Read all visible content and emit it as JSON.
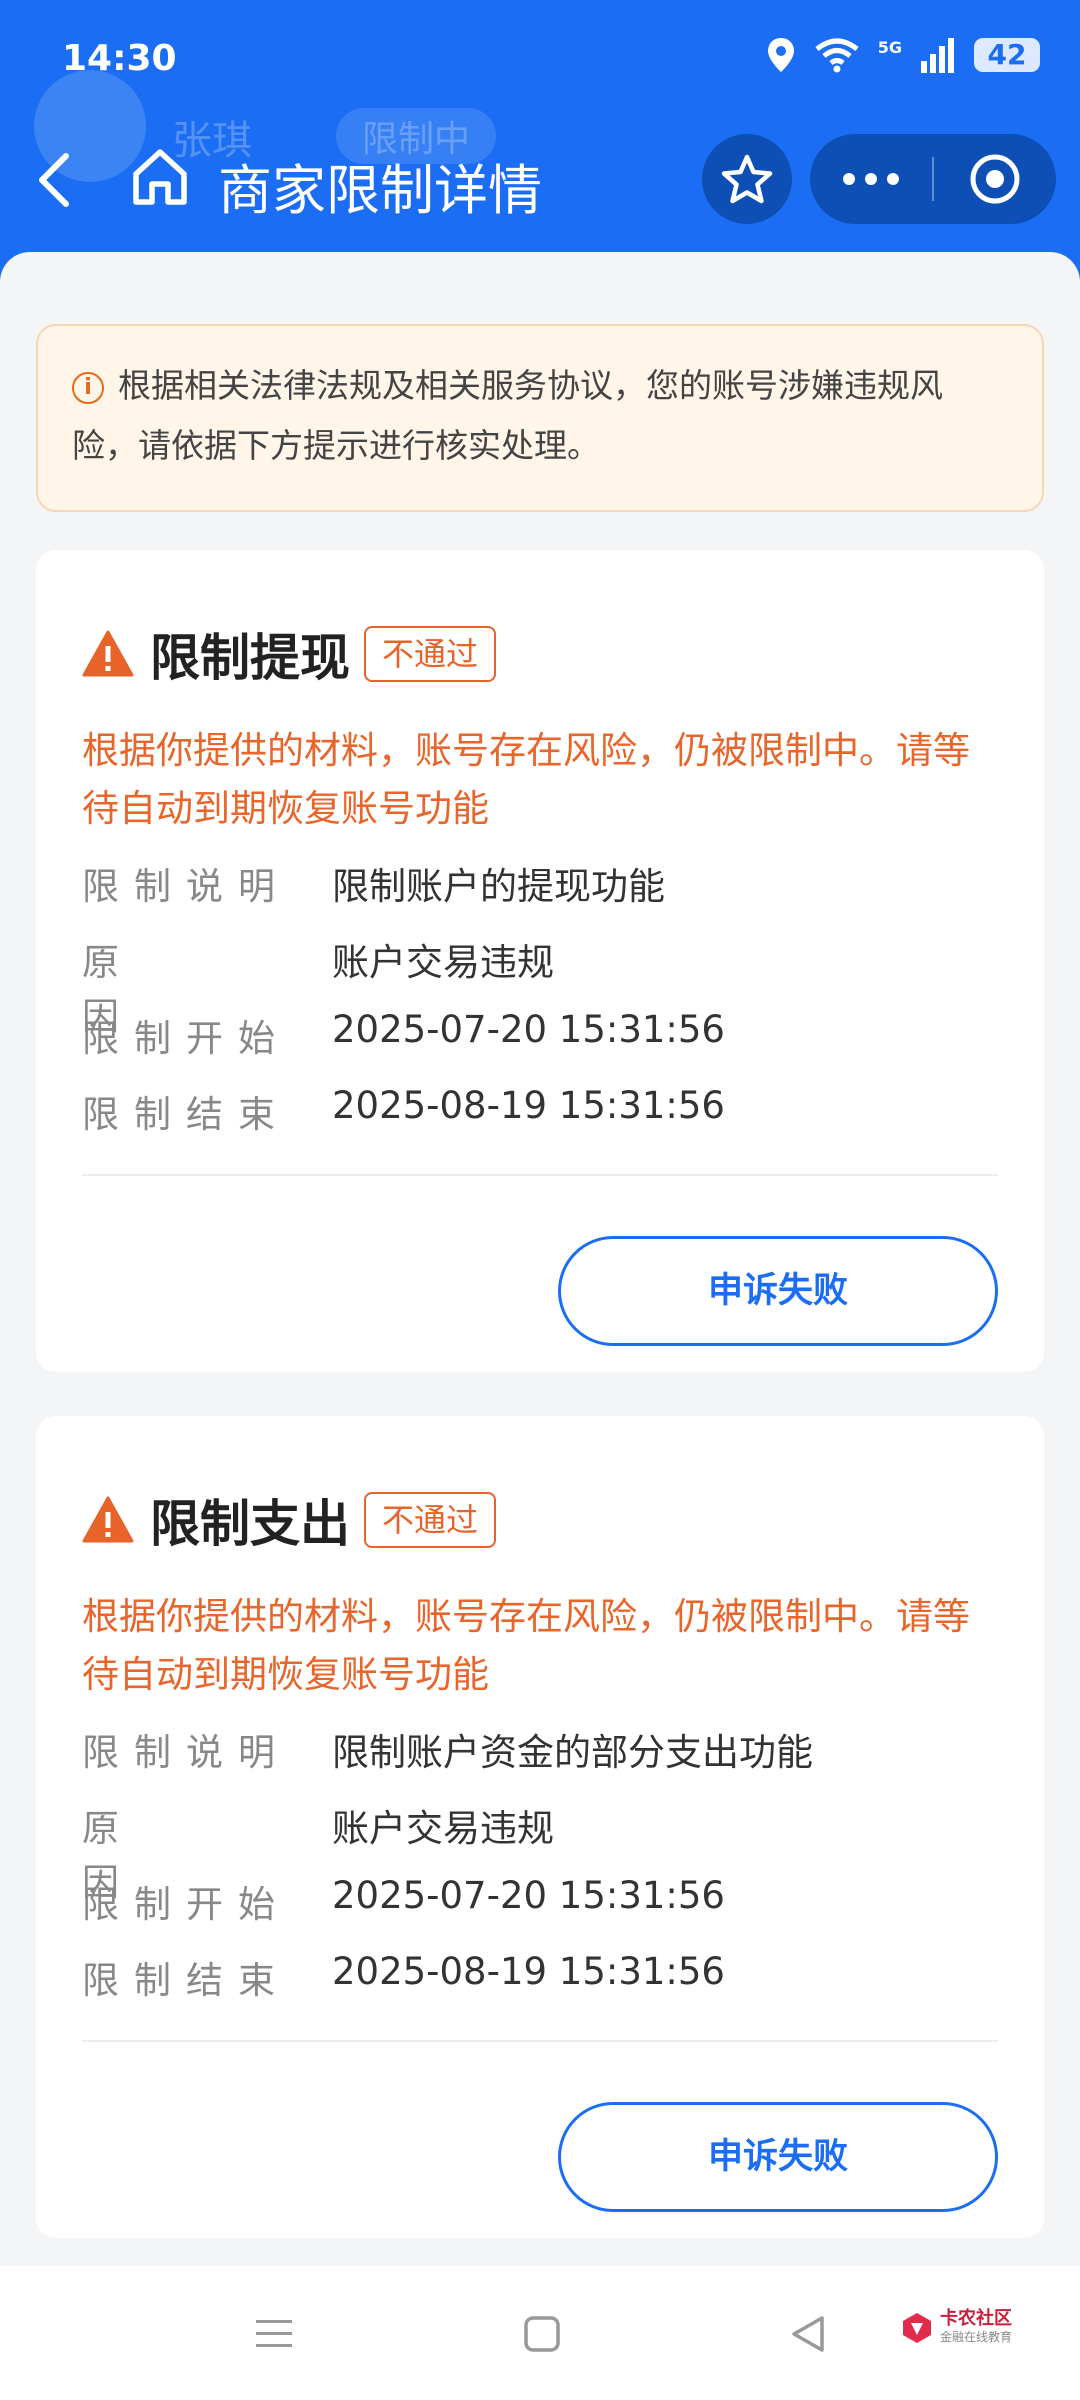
{
  "status_bar": {
    "time": "14:30",
    "network": "5G",
    "battery": "42"
  },
  "header": {
    "title": "商家限制详情",
    "background_name": "张琪",
    "background_status": "限制中"
  },
  "notice": {
    "text": "根据相关法律法规及相关服务协议，您的账号涉嫌违规风险，请依据下方提示进行核实处理。"
  },
  "cards": [
    {
      "title": "限制提现",
      "badge": "不通过",
      "message": "根据你提供的材料，账号存在风险，仍被限制中。请等待自动到期恢复账号功能",
      "rows": [
        {
          "label": "限制说明",
          "value": "限制账户的提现功能"
        },
        {
          "label": "原因",
          "value": "账户交易违规"
        },
        {
          "label": "限制开始",
          "value": "2025-07-20 15:31:56"
        },
        {
          "label": "限制结束",
          "value": "2025-08-19 15:31:56"
        }
      ],
      "button": "申诉失败"
    },
    {
      "title": "限制支出",
      "badge": "不通过",
      "message": "根据你提供的材料，账号存在风险，仍被限制中。请等待自动到期恢复账号功能",
      "rows": [
        {
          "label": "限制说明",
          "value": "限制账户资金的部分支出功能"
        },
        {
          "label": "原因",
          "value": "账户交易违规"
        },
        {
          "label": "限制开始",
          "value": "2025-07-20 15:31:56"
        },
        {
          "label": "限制结束",
          "value": "2025-08-19 15:31:56"
        }
      ],
      "button": "申诉失败"
    }
  ],
  "watermark": {
    "name": "卡农社区",
    "sub": "金融在线教育"
  },
  "colors": {
    "primary": "#1b6ef3",
    "warning": "#e8632a",
    "notice_bg": "#fff5e9"
  }
}
